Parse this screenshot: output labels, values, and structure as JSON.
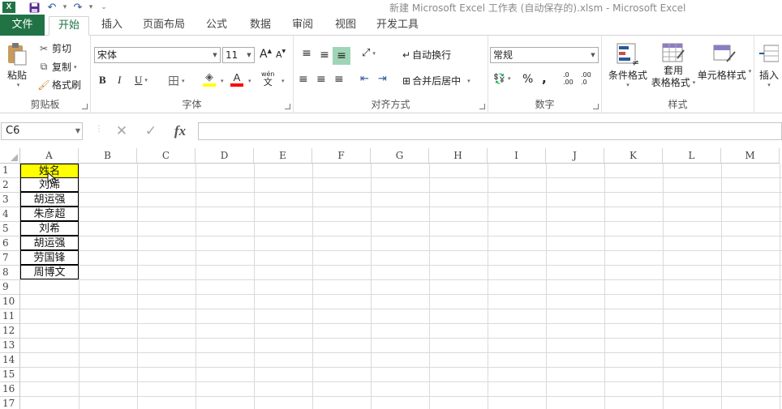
{
  "window": {
    "title": "新建 Microsoft Excel 工作表 (自动保存的).xlsm - Microsoft Excel",
    "app_icon": "X"
  },
  "tabs": [
    "文件",
    "开始",
    "插入",
    "页面布局",
    "公式",
    "数据",
    "审阅",
    "视图",
    "开发工具"
  ],
  "active_tab": "开始",
  "clipboard": {
    "paste": "粘贴",
    "cut": "剪切",
    "copy": "复制",
    "format_painter": "格式刷",
    "label": "剪贴板"
  },
  "font": {
    "name": "宋体",
    "size": "11",
    "grow": "A",
    "shrink": "A",
    "bold": "B",
    "italic": "I",
    "underline": "U",
    "border": "田",
    "fill_color": "#ffff00",
    "font_color": "#ff0000",
    "phonetic": "wén",
    "phonetic_char": "文",
    "label": "字体"
  },
  "alignment": {
    "wrap": "自动换行",
    "merge": "合并后居中",
    "label": "对齐方式"
  },
  "number": {
    "format": "常规",
    "percent": "%",
    "comma": ",",
    "inc": ".0\n.00",
    "dec": ".00\n.0",
    "label": "数字"
  },
  "styles": {
    "conditional": "条件格式",
    "table_line1": "套用",
    "table_line2": "表格格式",
    "cell_styles": "单元格样式",
    "label": "样式"
  },
  "cells_group": {
    "insert": "插入"
  },
  "formula_bar": {
    "name_box": "C6",
    "cancel": "✕",
    "enter": "✓",
    "fx": "fx",
    "formula": ""
  },
  "columns": [
    "A",
    "B",
    "C",
    "D",
    "E",
    "F",
    "G",
    "H",
    "I",
    "J",
    "K",
    "L",
    "M"
  ],
  "rows": [
    "1",
    "2",
    "3",
    "4",
    "5",
    "6",
    "7",
    "8",
    "9",
    "10",
    "11",
    "12",
    "13",
    "14",
    "15",
    "16",
    "17"
  ],
  "cells": [
    "姓名",
    "刘烯",
    "胡运强",
    "朱彦超",
    "刘希",
    "胡运强",
    "劳国锋",
    "周博文"
  ],
  "colors": {
    "excel_green": "#217346",
    "header_fill": "#ffff00"
  }
}
